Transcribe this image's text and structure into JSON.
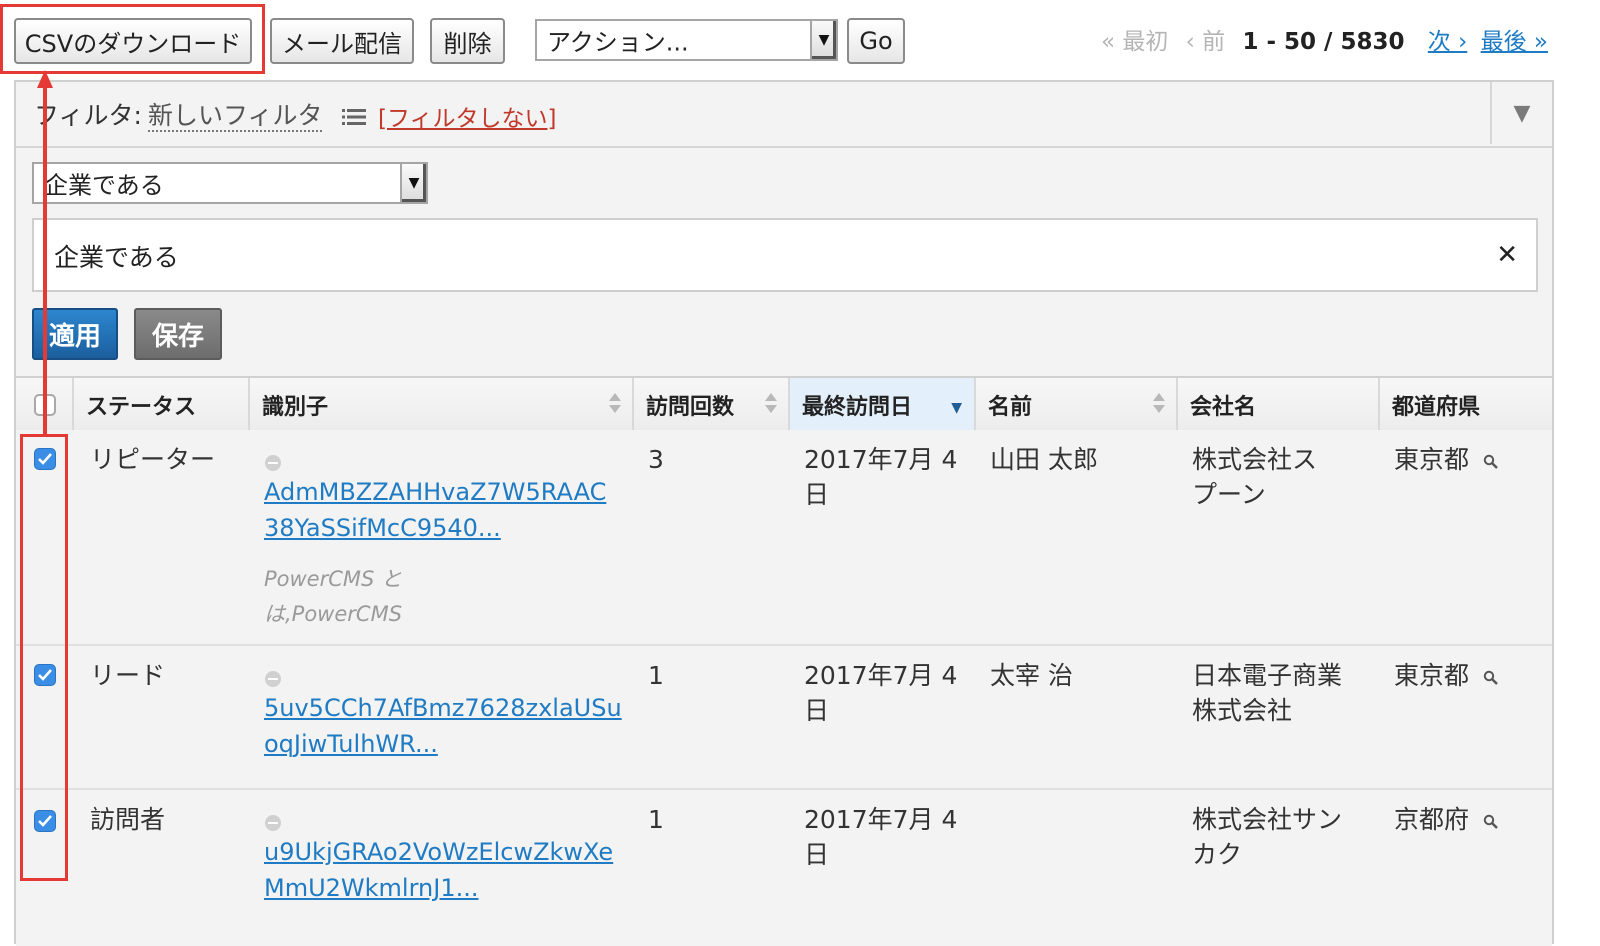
{
  "toolbar": {
    "csv_label": "CSVのダウンロード",
    "mail_label": "メール配信",
    "delete_label": "削除",
    "action_select": "アクション...",
    "go_label": "Go"
  },
  "pager": {
    "first": "« 最初",
    "prev": "‹ 前",
    "range": "1 - 50 / 5830",
    "next": "次 ›",
    "last": "最後 »"
  },
  "filter": {
    "label": "フィルタ:",
    "name": "新しいフィルタ",
    "no_filter": "[フィルタしない]",
    "field_select": "企業である",
    "condition_text": "企業である",
    "apply_label": "適用",
    "save_label": "保存"
  },
  "table": {
    "headers": {
      "status": "ステータス",
      "identifier": "識別子",
      "visits": "訪問回数",
      "last_visit": "最終訪問日",
      "name": "名前",
      "company": "会社名",
      "prefecture": "都道府県"
    },
    "rows": [
      {
        "checked": true,
        "status": "リピーター",
        "id_line1": "AdmMBZZAHHvaZ7W5RAAC",
        "id_line2": "38YaSSifMcC9540...",
        "note_line1": "PowerCMS と",
        "note_line2": "は,PowerCMS",
        "visits": "3",
        "date_line1": "2017年7月 4",
        "date_line2": "日",
        "name": "山田 太郎",
        "company_line1": "株式会社ス",
        "company_line2": "プーン",
        "prefecture": "東京都"
      },
      {
        "checked": true,
        "status": "リード",
        "id_line1": "5uv5CCh7AfBmz7628zxlaUSu",
        "id_line2": "oqJiwTulhWR...",
        "visits": "1",
        "date_line1": "2017年7月 4",
        "date_line2": "日",
        "name": "太宰 治",
        "company_line1": "日本電子商業",
        "company_line2": "株式会社",
        "prefecture": "東京都"
      },
      {
        "checked": true,
        "status": "訪問者",
        "id_line1": "u9UkjGRAo2VoWzElcwZkwXe",
        "id_line2": "MmU2WkmlrnJ1...",
        "visits": "1",
        "date_line1": "2017年7月 4",
        "date_line2": "日",
        "name": "",
        "company_line1": "株式会社サン",
        "company_line2": "カク",
        "prefecture": "京都府"
      }
    ]
  },
  "colors": {
    "accent": "#1f7bc4",
    "highlight": "#e53935",
    "apply": "#1b5f9e"
  }
}
